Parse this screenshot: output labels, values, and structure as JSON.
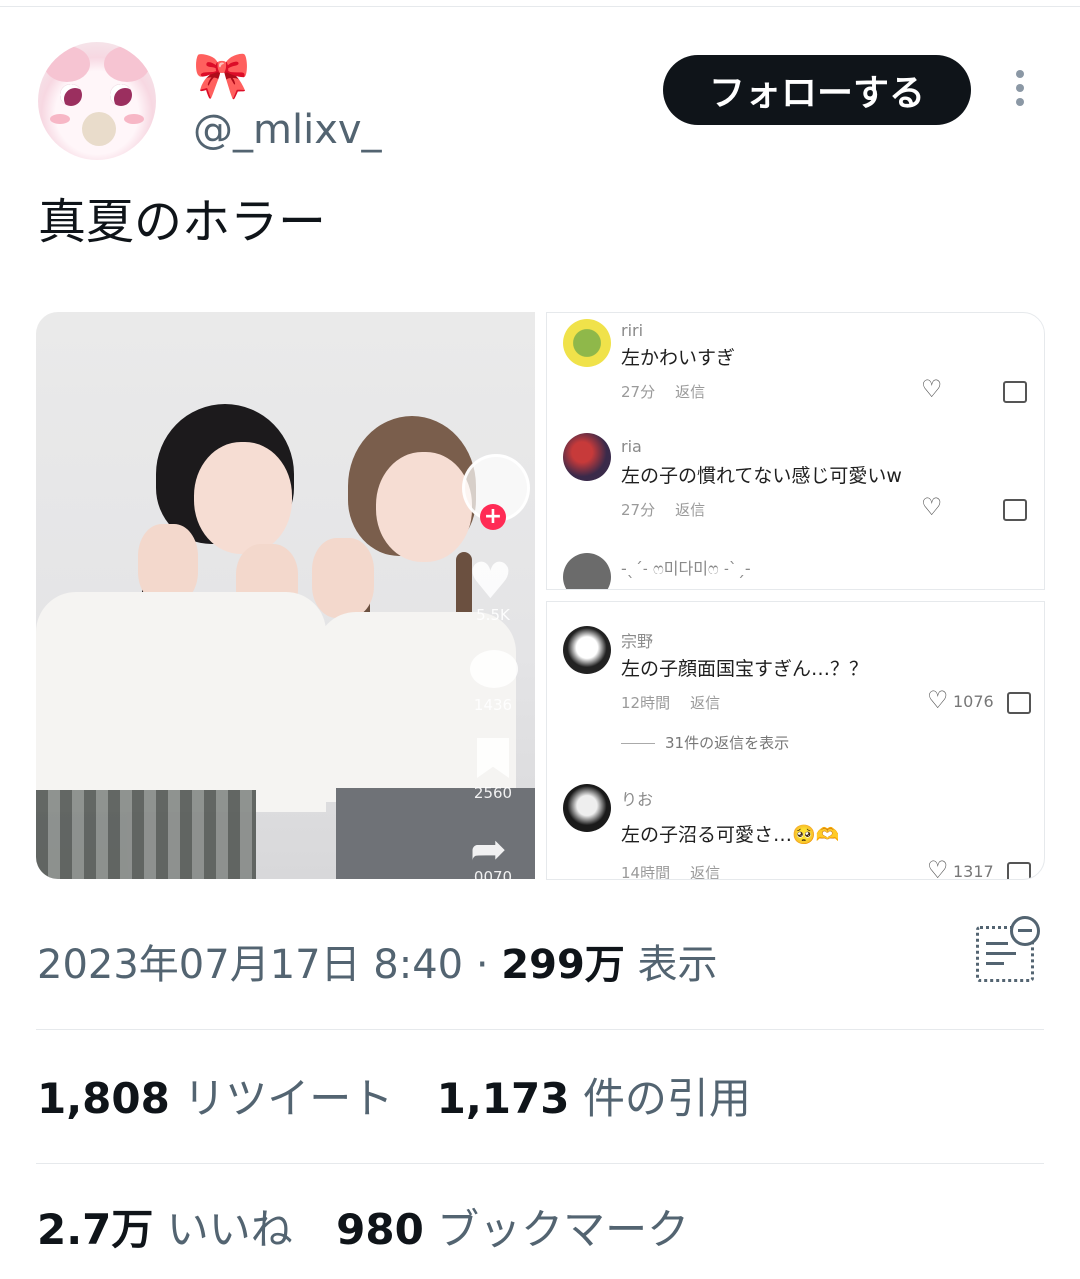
{
  "header": {
    "display_name_emoji": "🎀",
    "handle": "@_mlixv_",
    "follow_label": "フォローする"
  },
  "tweet": {
    "text": "真夏のホラー"
  },
  "media": {
    "video_overlay": {
      "likes": "5.5K",
      "comments": "1436",
      "bookmarks": "2560",
      "shares": "0070"
    },
    "comments_top": [
      {
        "user": "riri",
        "text": "左かわいすぎ",
        "time": "27分",
        "reply": "返信"
      },
      {
        "user": "ria",
        "text": "左の子の慣れてない感じ可愛いw",
        "time": "27分",
        "reply": "返信"
      },
      {
        "user": "-ˎˊ˗ ෆ미다미ෆ ˗ˋˏ-"
      }
    ],
    "comments_bottom": [
      {
        "user": "宗野",
        "text": "左の子顔面国宝すぎん…？？",
        "time": "12時間",
        "reply": "返信",
        "likes": "1076",
        "replies_link": "31件の返信を表示"
      },
      {
        "user": "りお",
        "text": "左の子沼る可愛さ…🥺🫶",
        "time": "14時間",
        "reply": "返信",
        "likes": "1317"
      }
    ]
  },
  "meta": {
    "date": "2023年07月17日 8:40",
    "separator": "·",
    "views_count": "299万",
    "views_label": "表示"
  },
  "stats": {
    "retweets_count": "1,808",
    "retweets_label": "リツイート",
    "quotes_count": "1,173",
    "quotes_label": "件の引用",
    "likes_count": "2.7万",
    "likes_label": "いいね",
    "bookmarks_count": "980",
    "bookmarks_label": "ブックマーク"
  },
  "colors": {
    "text_primary": "#0f1419",
    "text_secondary": "#536471",
    "follow_button_bg": "#0f1419",
    "divider": "#e6e9ec"
  },
  "icons": [
    "more-vertical-icon",
    "analytics-icon",
    "heart-icon",
    "dislike-icon",
    "share-icon",
    "bookmark-icon",
    "comment-icon"
  ]
}
